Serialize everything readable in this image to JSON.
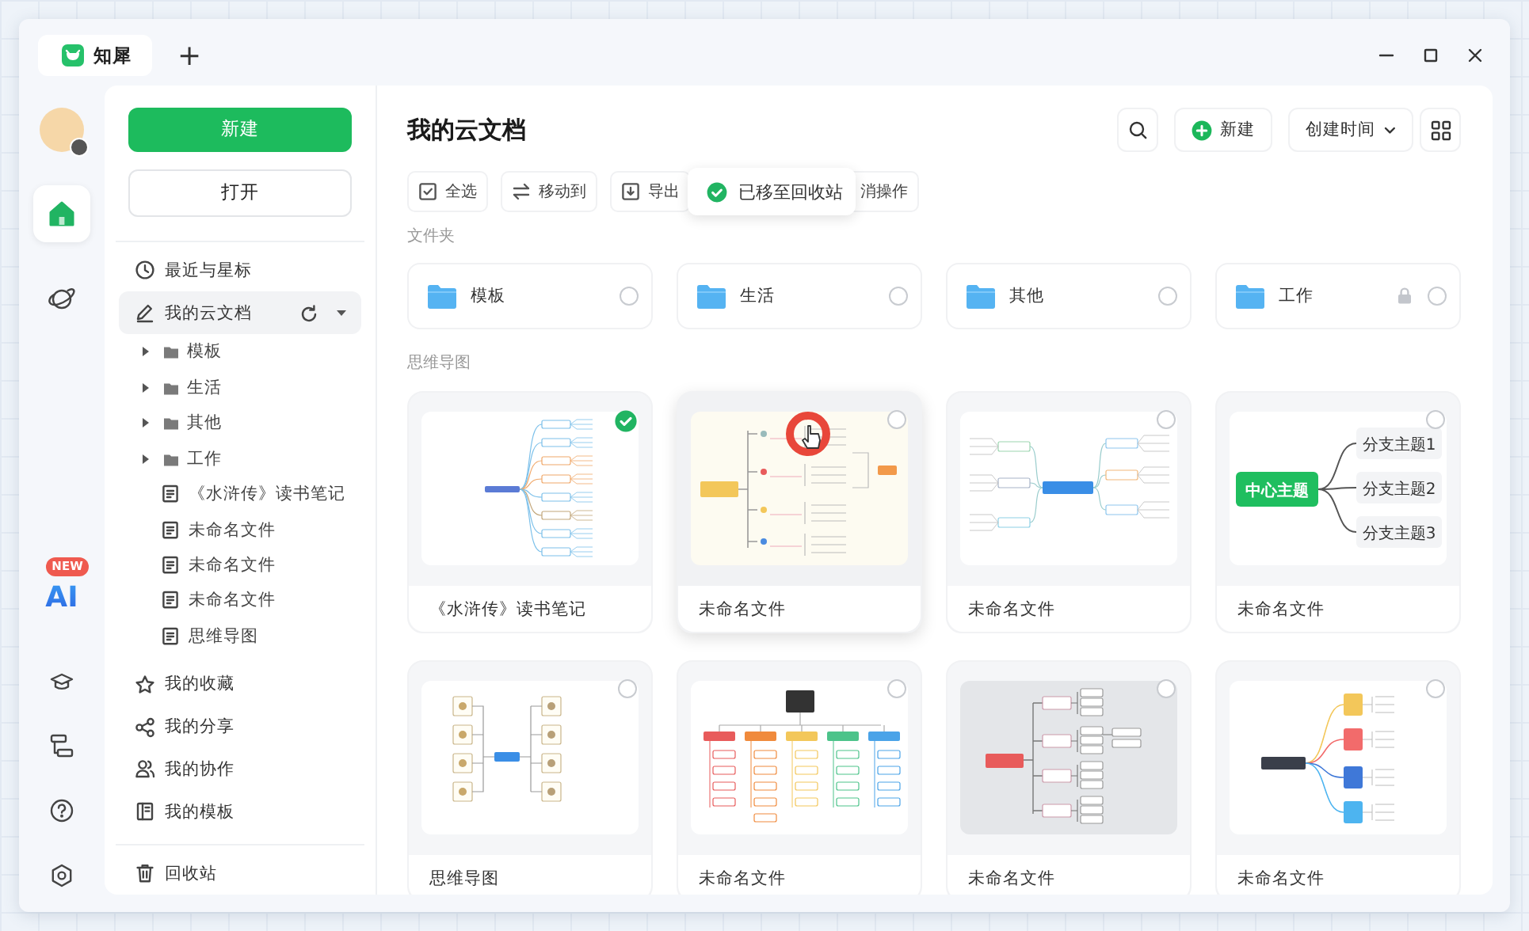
{
  "tab": {
    "title": "知犀",
    "add": "+"
  },
  "rail": {
    "top": [
      {
        "kind": "home",
        "selected": true
      },
      {
        "kind": "explore",
        "selected": false
      }
    ],
    "ai": {
      "label": "AI",
      "badge": "NEW"
    },
    "bottom": [
      {
        "kind": "learn",
        "selected": false
      },
      {
        "kind": "flow",
        "selected": false
      },
      {
        "kind": "help",
        "selected": false
      },
      {
        "kind": "settings",
        "selected": false
      }
    ]
  },
  "sidebar": {
    "new_button": "新建",
    "open_button": "打开",
    "nav": [
      {
        "kind": "recent",
        "label": "最近与星标",
        "selected": false
      },
      {
        "kind": "cloud",
        "label": "我的云文档",
        "selected": true,
        "expanded": true,
        "children": [
          {
            "kind": "folder",
            "label": "模板",
            "expanded": false
          },
          {
            "kind": "folder",
            "label": "生活",
            "expanded": false
          },
          {
            "kind": "folder",
            "label": "其他",
            "expanded": false
          },
          {
            "kind": "folder",
            "label": "工作",
            "expanded": false
          },
          {
            "kind": "file",
            "label": "《水浒传》读书笔记"
          },
          {
            "kind": "file",
            "label": "未命名文件"
          },
          {
            "kind": "file",
            "label": "未命名文件"
          },
          {
            "kind": "file",
            "label": "未命名文件"
          },
          {
            "kind": "file",
            "label": "思维导图"
          }
        ]
      },
      {
        "kind": "favorites",
        "label": "我的收藏",
        "selected": false
      },
      {
        "kind": "shared",
        "label": "我的分享",
        "selected": false
      },
      {
        "kind": "collab",
        "label": "我的协作",
        "selected": false
      },
      {
        "kind": "templates",
        "label": "我的模板",
        "selected": false
      }
    ],
    "trash": {
      "label": "回收站",
      "selected": false
    }
  },
  "main": {
    "title": "我的云文档",
    "new_button": "新建",
    "sort": "创建时间",
    "toolbar": [
      {
        "kind": "select-all",
        "label": "全选"
      },
      {
        "kind": "move",
        "label": "移动到"
      },
      {
        "kind": "export",
        "label": "导出"
      },
      {
        "kind": "undo",
        "label": "消操作"
      }
    ],
    "toast": "已移至回收站",
    "folders_label": "文件夹",
    "folders": [
      {
        "name": "模板",
        "locked": false,
        "selected": false
      },
      {
        "name": "生活",
        "locked": false,
        "selected": false
      },
      {
        "name": "其他",
        "locked": false,
        "selected": false
      },
      {
        "name": "工作",
        "locked": true,
        "selected": false
      }
    ],
    "mindmaps_label": "思维导图",
    "mindmaps": [
      {
        "title": "《水浒传》读书笔记",
        "selected": true,
        "hovered": false,
        "preview": {
          "kind": "tree"
        }
      },
      {
        "title": "未命名文件",
        "selected": false,
        "hovered": true,
        "preview": {
          "kind": "logic"
        }
      },
      {
        "title": "未命名文件",
        "selected": false,
        "hovered": false,
        "preview": {
          "kind": "radial"
        }
      },
      {
        "title": "未命名文件",
        "selected": false,
        "hovered": false,
        "preview": {
          "kind": "topic",
          "center": "中心主题",
          "branches": [
            "分支主题1",
            "分支主题2",
            "分支主题3"
          ]
        }
      },
      {
        "title": "思维导图",
        "selected": false,
        "hovered": false,
        "preview": {
          "kind": "icons"
        }
      },
      {
        "title": "未命名文件",
        "selected": false,
        "hovered": false,
        "preview": {
          "kind": "org"
        }
      },
      {
        "title": "未命名文件",
        "selected": false,
        "hovered": false,
        "preview": {
          "kind": "bracket"
        }
      },
      {
        "title": "未命名文件",
        "selected": false,
        "hovered": false,
        "preview": {
          "kind": "timeline"
        }
      }
    ]
  }
}
